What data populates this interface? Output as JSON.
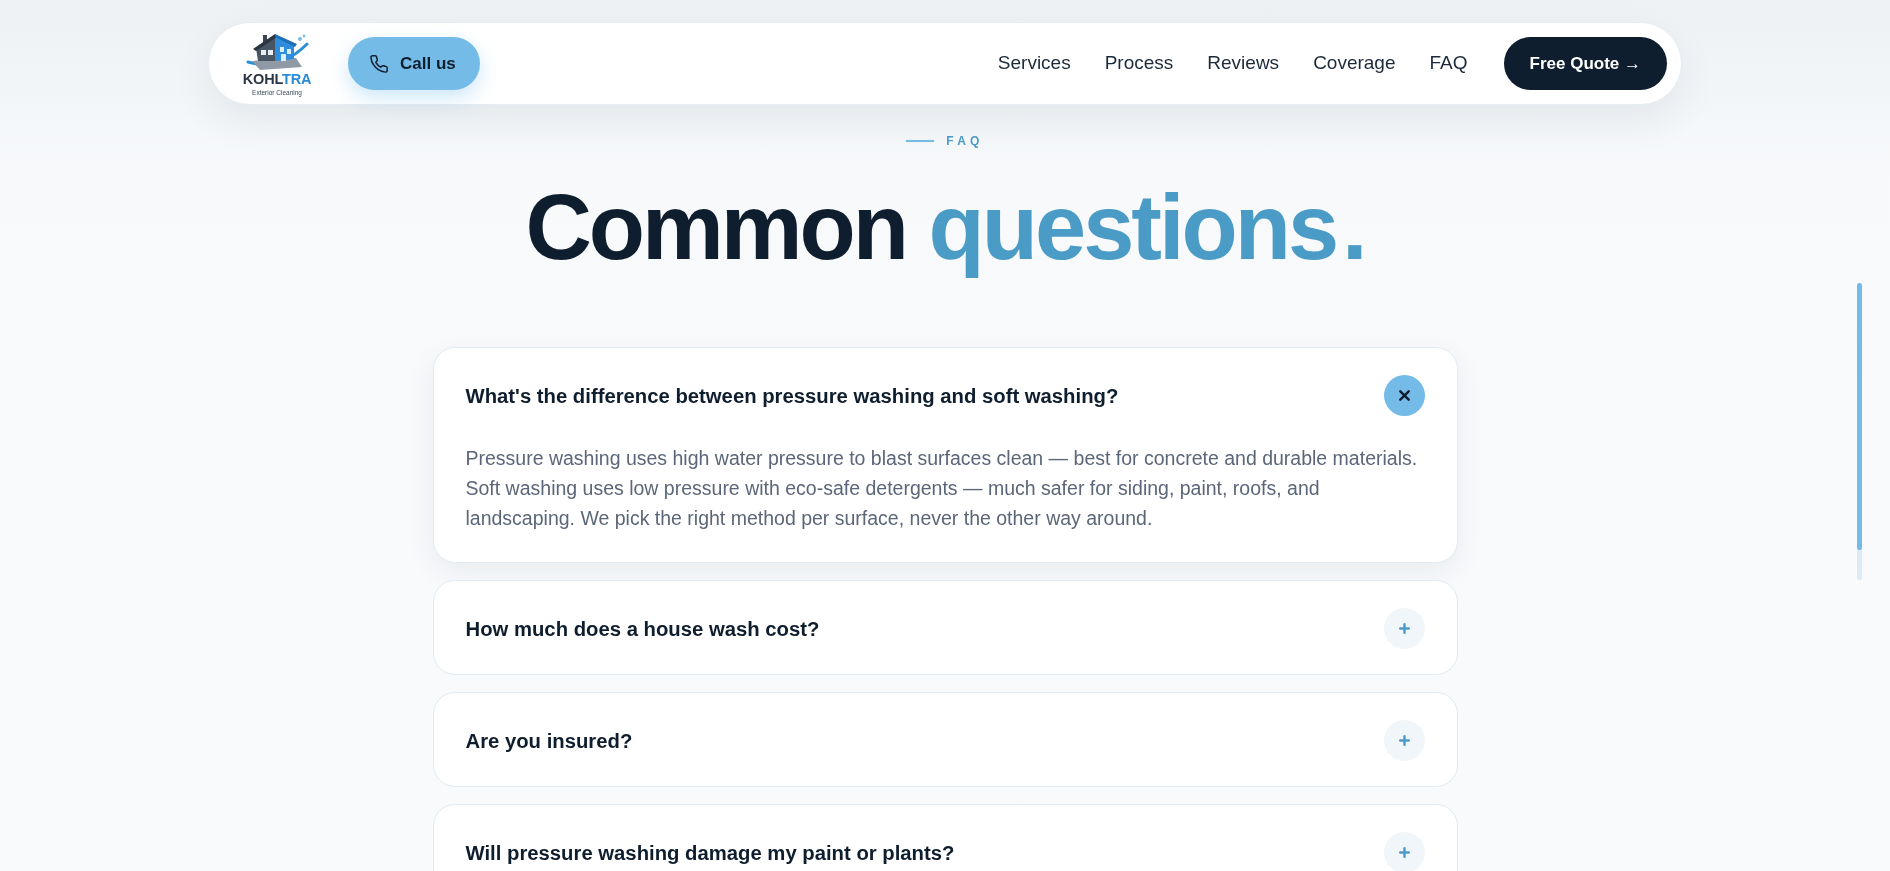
{
  "nav": {
    "brand": {
      "name_main": "KOHL",
      "name_accent": "TRA",
      "tagline": "Exterior Cleaning"
    },
    "call_button": {
      "label": "Call us"
    },
    "links": [
      "Services",
      "Process",
      "Reviews",
      "Coverage",
      "FAQ"
    ],
    "cta": {
      "label": "Free Quote →"
    }
  },
  "faq": {
    "eyebrow": "FAQ",
    "heading": {
      "main": "Common",
      "accent": "questions",
      "end_mark": "."
    },
    "items": [
      {
        "question": "What's the difference between pressure washing and soft washing?",
        "answer": "Pressure washing uses high water pressure to blast surfaces clean — best for concrete and durable materials. Soft washing uses low pressure with eco-safe detergents — much safer for siding, paint, roofs, and landscaping. We pick the right method per surface, never the other way around.",
        "expanded": true
      },
      {
        "question": "How much does a house wash cost?",
        "expanded": false
      },
      {
        "question": "Are you insured?",
        "expanded": false
      },
      {
        "question": "Will pressure washing damage my paint or plants?",
        "expanded": false
      }
    ]
  }
}
